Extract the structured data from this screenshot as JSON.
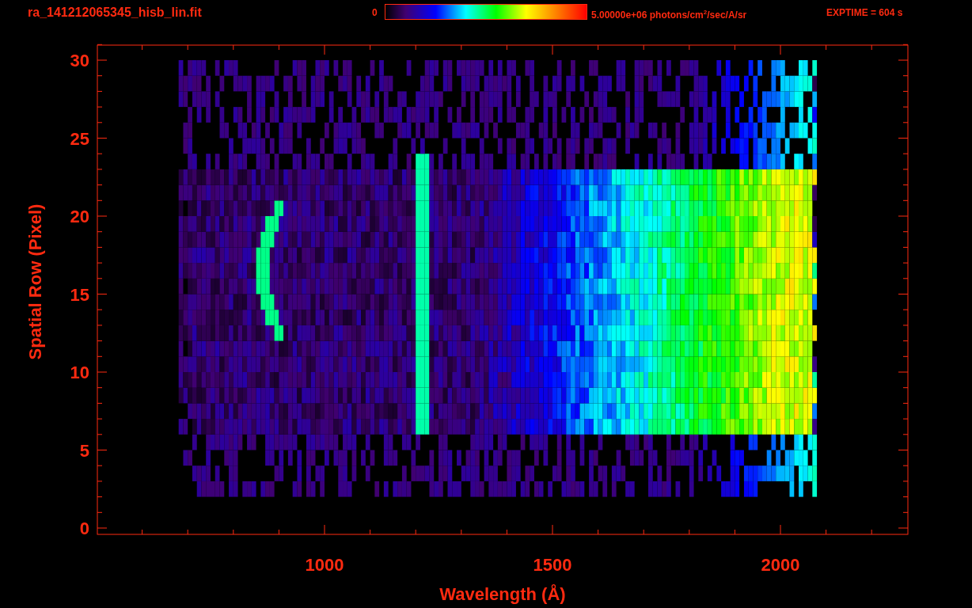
{
  "header": {
    "file_name": "ra_141212065345_hisb_lin.fit",
    "scale_min": "0",
    "scale_max": "5.00000e+06 photons/cm$^{2}$/sec/A/sr",
    "exposure": "EXPTIME = 604 s"
  },
  "plot": {
    "y_axis": {
      "title": "Spatial Row (Pixel)",
      "tick_labels": [
        "30",
        "25",
        "20",
        "15",
        "10",
        "5",
        "0"
      ]
    },
    "x_axis": {
      "title": "Wavelength (Å)",
      "tick_labels": [
        "1000",
        "1500",
        "2000"
      ]
    }
  }
}
